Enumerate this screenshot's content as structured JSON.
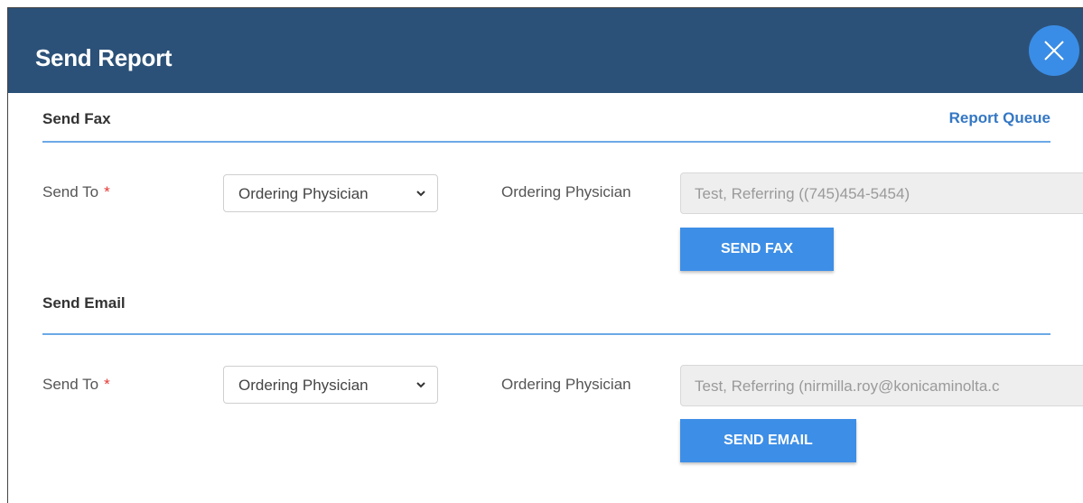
{
  "dialog": {
    "title": "Send Report",
    "close_icon": "close-icon"
  },
  "fax": {
    "section_title": "Send Fax",
    "report_queue_link": "Report Queue",
    "send_to_label": "Send To",
    "required_marker": "*",
    "send_to_value": "Ordering Physician",
    "recipient_label": "Ordering Physician",
    "recipient_value": "Test, Referring ((745)454-5454)",
    "send_button": "SEND FAX"
  },
  "email": {
    "section_title": "Send Email",
    "send_to_label": "Send To",
    "required_marker": "*",
    "send_to_value": "Ordering Physician",
    "recipient_label": "Ordering Physician",
    "recipient_value": "Test, Referring (nirmilla.roy@konicaminolta.c",
    "send_button": "SEND EMAIL"
  },
  "colors": {
    "header_bg": "#2c5178",
    "accent": "#3d8ee6",
    "link": "#3477c4",
    "required": "#e53935"
  }
}
